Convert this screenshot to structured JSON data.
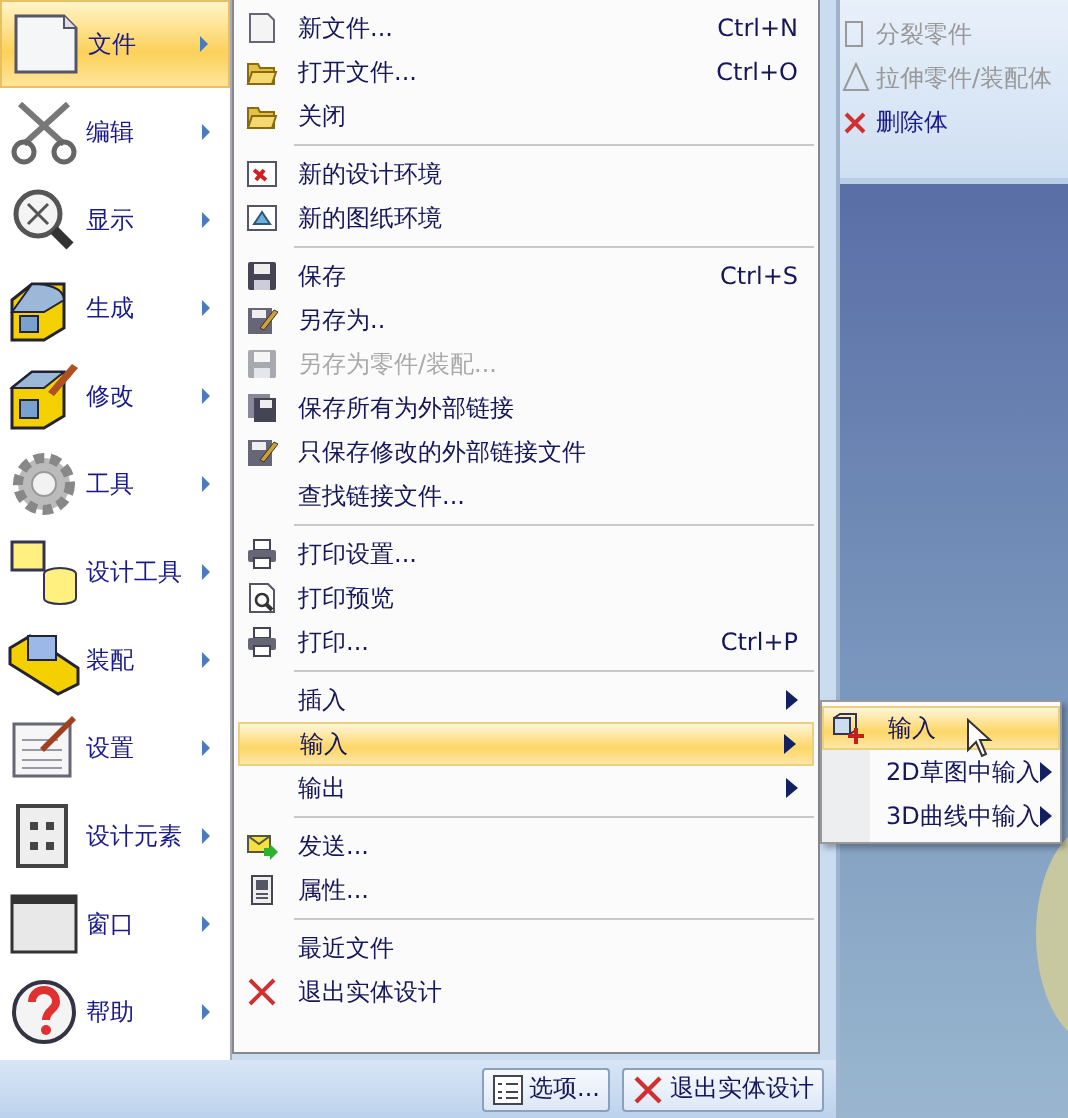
{
  "side_menu": {
    "items": [
      {
        "label": "文件",
        "selected": true
      },
      {
        "label": "编辑",
        "selected": false
      },
      {
        "label": "显示",
        "selected": false
      },
      {
        "label": "生成",
        "selected": false
      },
      {
        "label": "修改",
        "selected": false
      },
      {
        "label": "工具",
        "selected": false
      },
      {
        "label": "设计工具",
        "selected": false
      },
      {
        "label": "装配",
        "selected": false
      },
      {
        "label": "设置",
        "selected": false
      },
      {
        "label": "设计元素",
        "selected": false
      },
      {
        "label": "窗口",
        "selected": false
      },
      {
        "label": "帮助",
        "selected": false
      }
    ]
  },
  "file_menu": {
    "items": [
      {
        "kind": "item",
        "label": "新文件...",
        "shortcut": "Ctrl+N",
        "disabled": false,
        "has_submenu": false,
        "selected": false
      },
      {
        "kind": "item",
        "label": "打开文件...",
        "shortcut": "Ctrl+O",
        "disabled": false,
        "has_submenu": false,
        "selected": false
      },
      {
        "kind": "item",
        "label": "关闭",
        "disabled": false,
        "has_submenu": false,
        "selected": false
      },
      {
        "kind": "separator"
      },
      {
        "kind": "item",
        "label": "新的设计环境",
        "disabled": false,
        "has_submenu": false,
        "selected": false
      },
      {
        "kind": "item",
        "label": "新的图纸环境",
        "disabled": false,
        "has_submenu": false,
        "selected": false
      },
      {
        "kind": "separator"
      },
      {
        "kind": "item",
        "label": "保存",
        "shortcut": "Ctrl+S",
        "disabled": false,
        "has_submenu": false,
        "selected": false
      },
      {
        "kind": "item",
        "label": "另存为..",
        "disabled": false,
        "has_submenu": false,
        "selected": false
      },
      {
        "kind": "item",
        "label": "另存为零件/装配...",
        "disabled": true,
        "has_submenu": false,
        "selected": false
      },
      {
        "kind": "item",
        "label": "保存所有为外部链接",
        "disabled": false,
        "has_submenu": false,
        "selected": false
      },
      {
        "kind": "item",
        "label": "只保存修改的外部链接文件",
        "disabled": false,
        "has_submenu": false,
        "selected": false
      },
      {
        "kind": "item",
        "label": "查找链接文件...",
        "disabled": false,
        "has_submenu": false,
        "selected": false
      },
      {
        "kind": "separator"
      },
      {
        "kind": "item",
        "label": "打印设置...",
        "disabled": false,
        "has_submenu": false,
        "selected": false
      },
      {
        "kind": "item",
        "label": "打印预览",
        "disabled": false,
        "has_submenu": false,
        "selected": false
      },
      {
        "kind": "item",
        "label": "打印...",
        "shortcut": "Ctrl+P",
        "disabled": false,
        "has_submenu": false,
        "selected": false
      },
      {
        "kind": "separator"
      },
      {
        "kind": "item",
        "label": "插入",
        "disabled": false,
        "has_submenu": true,
        "selected": false
      },
      {
        "kind": "item",
        "label": "输入",
        "disabled": false,
        "has_submenu": true,
        "selected": true
      },
      {
        "kind": "item",
        "label": "输出",
        "disabled": false,
        "has_submenu": true,
        "selected": false
      },
      {
        "kind": "separator"
      },
      {
        "kind": "item",
        "label": "发送...",
        "disabled": false,
        "has_submenu": false,
        "selected": false
      },
      {
        "kind": "item",
        "label": "属性...",
        "disabled": false,
        "has_submenu": false,
        "selected": false
      },
      {
        "kind": "separator"
      },
      {
        "kind": "item",
        "label": "最近文件",
        "disabled": false,
        "has_submenu": false,
        "selected": false
      },
      {
        "kind": "item",
        "label": "退出实体设计",
        "disabled": false,
        "has_submenu": false,
        "selected": false
      }
    ]
  },
  "import_submenu": {
    "items": [
      {
        "label": "输入",
        "selected": true,
        "has_submenu": false
      },
      {
        "label": "2D草图中输入",
        "selected": false,
        "has_submenu": true
      },
      {
        "label": "3D曲线中输入",
        "selected": false,
        "has_submenu": true
      }
    ]
  },
  "bottom_buttons": [
    {
      "kind": "options",
      "label": "选项..."
    },
    {
      "kind": "exit",
      "label": "退出实体设计"
    }
  ],
  "ribbon": {
    "items": [
      {
        "label": "分裂零件",
        "disabled": true
      },
      {
        "label": "拉伸零件/装配体",
        "disabled": true
      },
      {
        "label": "删除体",
        "disabled": false
      }
    ]
  }
}
